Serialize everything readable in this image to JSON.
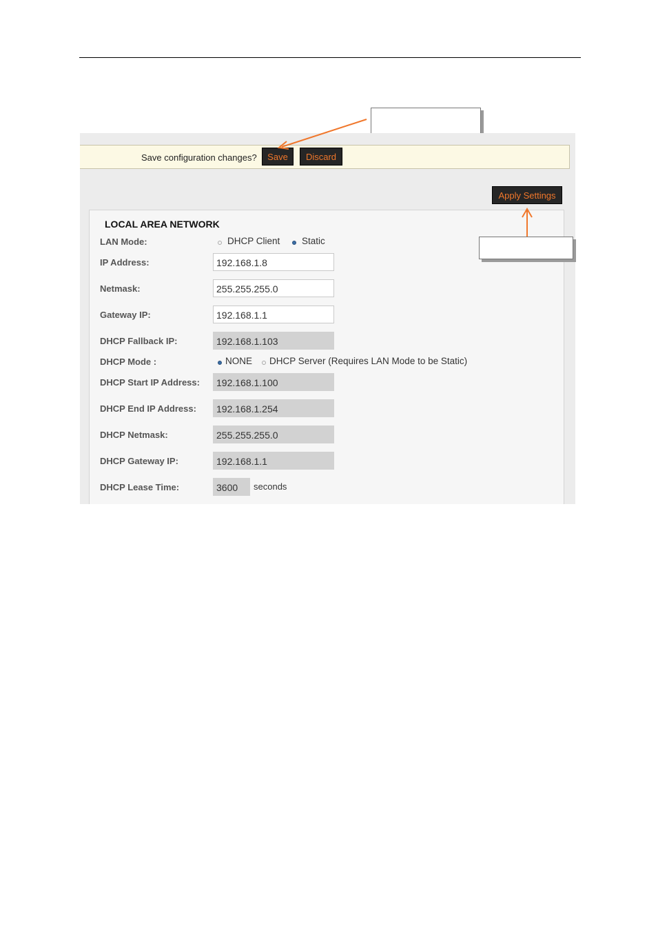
{
  "savebar": {
    "prompt": "Save configuration changes?",
    "save_label": "Save",
    "discard_label": "Discard"
  },
  "apply_label": "Apply Settings",
  "section_title": "LOCAL AREA NETWORK",
  "lan_mode": {
    "label": "LAN Mode:",
    "options": [
      "DHCP Client",
      "Static"
    ],
    "selected": "Static"
  },
  "fields": {
    "ip_address": {
      "label": "IP Address:",
      "value": "192.168.1.8"
    },
    "netmask": {
      "label": "Netmask:",
      "value": "255.255.255.0"
    },
    "gateway_ip": {
      "label": "Gateway IP:",
      "value": "192.168.1.1"
    },
    "dhcp_fallback_ip": {
      "label": "DHCP Fallback IP:",
      "value": "192.168.1.103"
    },
    "dhcp_start_ip": {
      "label": "DHCP Start IP Address:",
      "value": "192.168.1.100"
    },
    "dhcp_end_ip": {
      "label": "DHCP End IP Address:",
      "value": "192.168.1.254"
    },
    "dhcp_netmask": {
      "label": "DHCP Netmask:",
      "value": "255.255.255.0"
    },
    "dhcp_gateway_ip": {
      "label": "DHCP Gateway IP:",
      "value": "192.168.1.1"
    },
    "dhcp_lease_time": {
      "label": "DHCP Lease Time:",
      "value": "3600",
      "unit": "seconds"
    }
  },
  "dhcp_mode": {
    "label": "DHCP Mode :",
    "options": [
      "NONE",
      "DHCP Server (Requires LAN Mode to be Static)"
    ],
    "selected": "NONE"
  },
  "colors": {
    "accent_orange": "#f0772b",
    "button_dark": "#262626",
    "radio_selected": "#3a6ea5",
    "savebar_bg": "#fcf9e4"
  }
}
